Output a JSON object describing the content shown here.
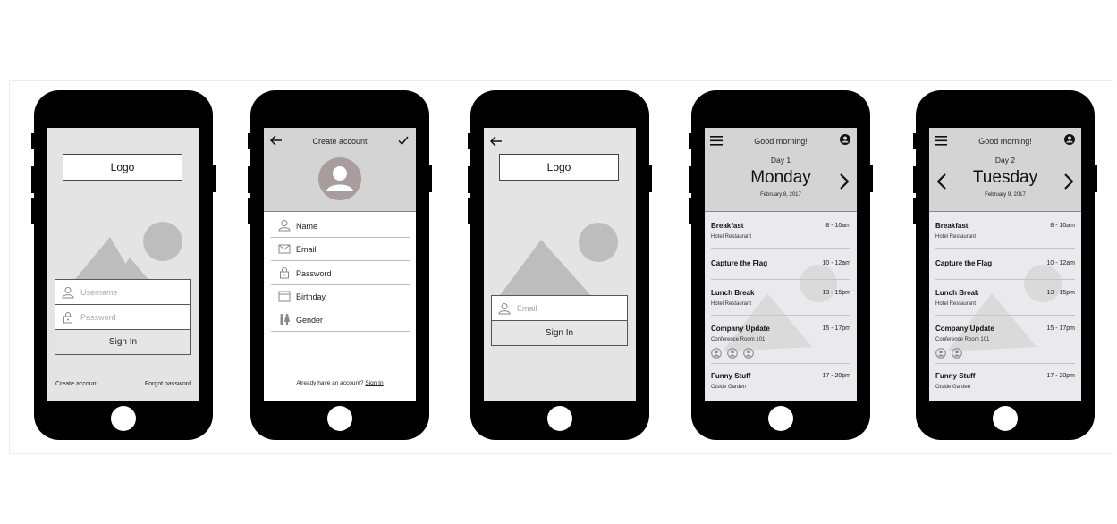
{
  "login": {
    "logo": "Logo",
    "username_placeholder": "Username",
    "password_placeholder": "Password",
    "sign_in": "Sign In",
    "create_account": "Create account",
    "forgot_password": "Forgot password"
  },
  "signup": {
    "title": "Create account",
    "fields": [
      "Name",
      "Email",
      "Password",
      "Birthday",
      "Gender"
    ],
    "footer_text": "Already have an account?",
    "footer_link": "Sign In"
  },
  "reset": {
    "logo": "Logo",
    "email_placeholder": "Email",
    "sign_in": "Sign In"
  },
  "day1": {
    "greeting": "Good morning!",
    "day_label": "Day 1",
    "weekday": "Monday",
    "date": "February 8, 2017",
    "events": [
      {
        "title": "Breakfast",
        "time": "8 - 10am",
        "location": "Hotel Restaurant"
      },
      {
        "title": "Capture the Flag",
        "time": "10 - 12am",
        "location": ""
      },
      {
        "title": "Lunch Break",
        "time": "13 - 15pm",
        "location": "Hotel Restaurant"
      },
      {
        "title": "Company Update",
        "time": "15 - 17pm",
        "location": "Conference Room 101"
      },
      {
        "title": "Funny Stuff",
        "time": "17 - 20pm",
        "location": "Otside Garden"
      }
    ]
  },
  "day2": {
    "greeting": "Good morning!",
    "day_label": "Day 2",
    "weekday": "Tuesday",
    "date": "February 9, 2017",
    "events": [
      {
        "title": "Breakfast",
        "time": "8 - 10am",
        "location": "Hotel Restaurant"
      },
      {
        "title": "Capture the Flag",
        "time": "10 - 12am",
        "location": ""
      },
      {
        "title": "Lunch Break",
        "time": "13 - 15pm",
        "location": "Hotel Restaurant"
      },
      {
        "title": "Company Update",
        "time": "15 - 17pm",
        "location": "Conference Room 101"
      },
      {
        "title": "Funny Stuff",
        "time": "17 - 20pm",
        "location": "Otside Garden"
      }
    ]
  },
  "colors": {
    "phone_body": "#000000",
    "screen_bg": "#e4e4e4",
    "header_bg": "#d4d4d4",
    "placeholder_shape": "#bdbdbd",
    "avatar": "#a89c9c"
  }
}
